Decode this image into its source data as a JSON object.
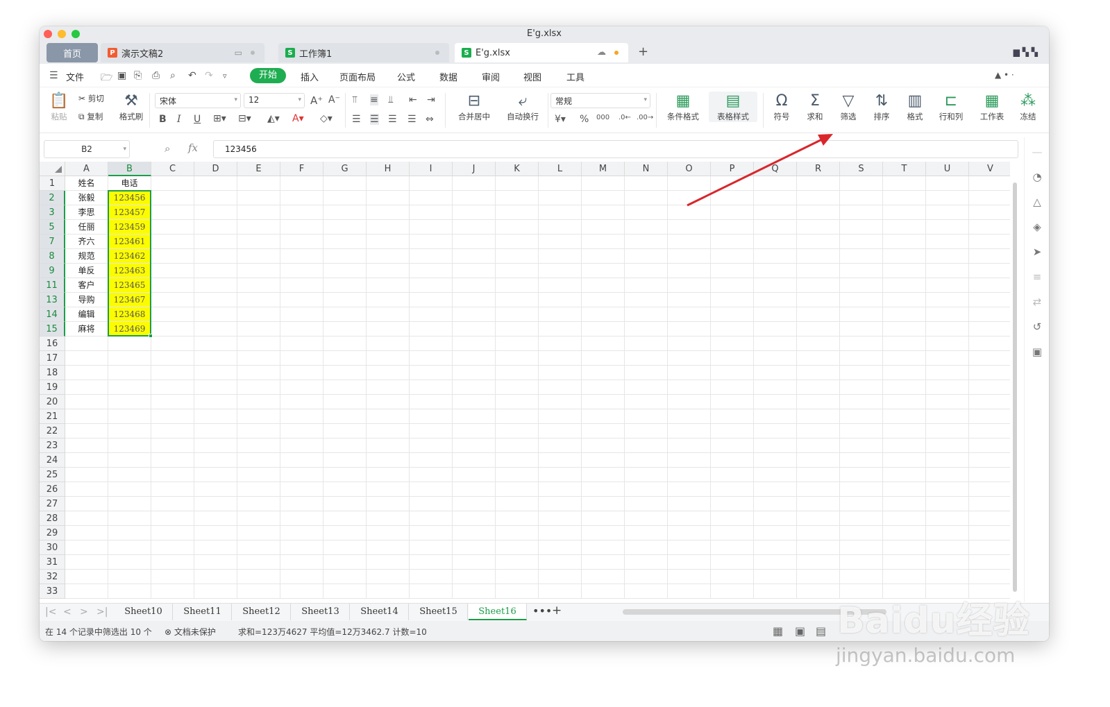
{
  "window": {
    "title": "E'g.xlsx"
  },
  "tabs": {
    "home": "首页",
    "items": [
      {
        "label": "演示文稿2",
        "kind": "presentation"
      },
      {
        "label": "工作簿1",
        "kind": "spreadsheet"
      },
      {
        "label": "E'g.xlsx",
        "kind": "spreadsheet",
        "active": true,
        "unsaved": true
      }
    ],
    "add": "+"
  },
  "menu": {
    "file": "文件",
    "items": [
      "开始",
      "插入",
      "页面布局",
      "公式",
      "数据",
      "审阅",
      "视图",
      "工具"
    ],
    "active": "开始"
  },
  "ribbon": {
    "paste": "粘贴",
    "cut": "剪切",
    "copy": "复制",
    "format_painter": "格式刷",
    "font_name": "宋体",
    "font_size": "12",
    "merge_center": "合并居中",
    "wrap_text": "自动换行",
    "number_format": "常规",
    "conditional_format": "条件格式",
    "table_style": "表格样式",
    "symbol": "符号",
    "sum": "求和",
    "filter": "筛选",
    "sort": "排序",
    "format": "格式",
    "row_col": "行和列",
    "worksheet": "工作表",
    "freeze": "冻结"
  },
  "formula_bar": {
    "name_box": "B2",
    "fx": "fx",
    "value": "123456"
  },
  "sheet": {
    "columns": [
      "A",
      "B",
      "C",
      "D",
      "E",
      "F",
      "G",
      "H",
      "I",
      "J",
      "K",
      "L",
      "M",
      "N",
      "O",
      "P",
      "Q",
      "R",
      "S",
      "T",
      "U",
      "V"
    ],
    "rows": [
      {
        "num": "1",
        "a": "姓名",
        "b": "电话"
      },
      {
        "num": "2",
        "a": "张毅",
        "b": "123456"
      },
      {
        "num": "3",
        "a": "李思",
        "b": "123457"
      },
      {
        "num": "5",
        "a": "任丽",
        "b": "123459"
      },
      {
        "num": "7",
        "a": "齐六",
        "b": "123461"
      },
      {
        "num": "8",
        "a": "规范",
        "b": "123462"
      },
      {
        "num": "9",
        "a": "单反",
        "b": "123463"
      },
      {
        "num": "11",
        "a": "客户",
        "b": "123465"
      },
      {
        "num": "13",
        "a": "导购",
        "b": "123467"
      },
      {
        "num": "14",
        "a": "编辑",
        "b": "123468"
      },
      {
        "num": "15",
        "a": "麻将",
        "b": "123469"
      },
      {
        "num": "16",
        "a": "",
        "b": ""
      },
      {
        "num": "17",
        "a": "",
        "b": ""
      },
      {
        "num": "18",
        "a": "",
        "b": ""
      },
      {
        "num": "19",
        "a": "",
        "b": ""
      },
      {
        "num": "20",
        "a": "",
        "b": ""
      },
      {
        "num": "21",
        "a": "",
        "b": ""
      },
      {
        "num": "22",
        "a": "",
        "b": ""
      },
      {
        "num": "23",
        "a": "",
        "b": ""
      },
      {
        "num": "24",
        "a": "",
        "b": ""
      },
      {
        "num": "25",
        "a": "",
        "b": ""
      },
      {
        "num": "26",
        "a": "",
        "b": ""
      },
      {
        "num": "27",
        "a": "",
        "b": ""
      },
      {
        "num": "28",
        "a": "",
        "b": ""
      },
      {
        "num": "29",
        "a": "",
        "b": ""
      },
      {
        "num": "30",
        "a": "",
        "b": ""
      },
      {
        "num": "31",
        "a": "",
        "b": ""
      },
      {
        "num": "32",
        "a": "",
        "b": ""
      },
      {
        "num": "33",
        "a": "",
        "b": ""
      }
    ],
    "highlight_color": "#fcfc00",
    "selection_color": "#1a9e48"
  },
  "sheet_tabs": {
    "items": [
      "Sheet10",
      "Sheet11",
      "Sheet12",
      "Sheet13",
      "Sheet14",
      "Sheet15",
      "Sheet16"
    ],
    "active": "Sheet16",
    "more": "•••",
    "add": "+"
  },
  "status": {
    "filter_info": "在 14 个记录中筛选出 10 个",
    "protection": "文档未保护",
    "stats": "求和=123万4627  平均值=12万3462.7  计数=10"
  },
  "watermark": {
    "logo": "Baidu经验",
    "url": "jingyan.baidu.com"
  },
  "colors": {
    "accent": "#1fad51",
    "annotation_arrow": "#d9262b"
  }
}
